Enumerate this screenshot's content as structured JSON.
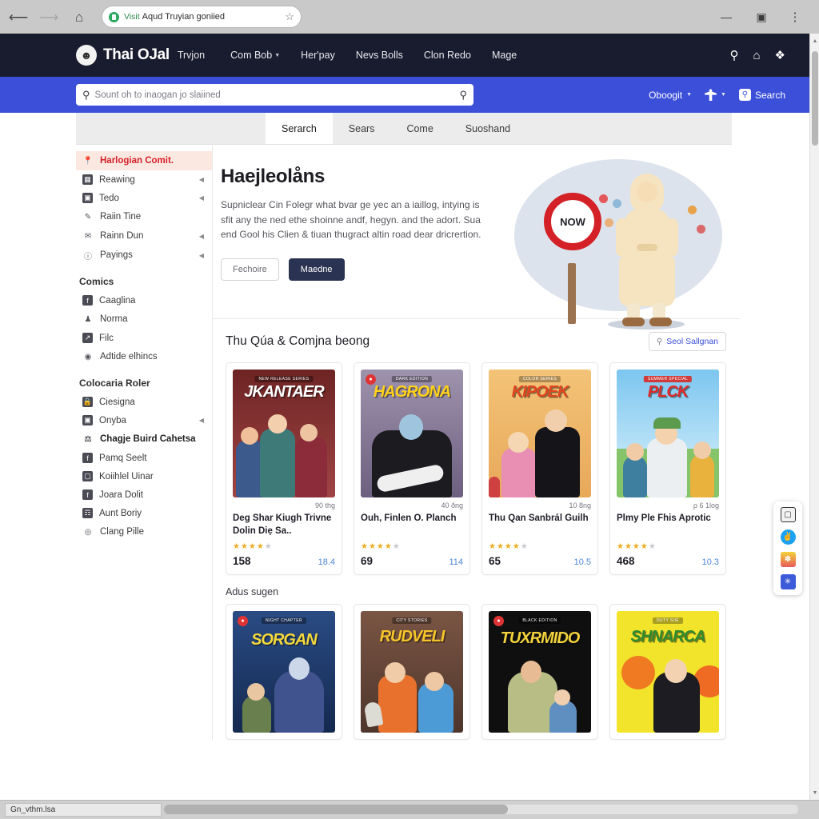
{
  "browser": {
    "back_icon": "back-arrow-icon",
    "forward_icon": "forward-arrow-icon",
    "home_icon": "home-icon",
    "secure_label": "Visit",
    "url_text": "Aqud Truyian goniied",
    "star_icon": "★",
    "minimize_label": "—",
    "maximize_label": "▣",
    "menu_label": "⋮"
  },
  "topnav": {
    "logo_glyph": "☻",
    "brand": "Thai OJal",
    "brand_sub": "Trvjon",
    "links": [
      {
        "label": "Com Bob",
        "has_caret": true
      },
      {
        "label": "Her'pay",
        "has_caret": false
      },
      {
        "label": "Nevs Bolls",
        "has_caret": false
      },
      {
        "label": "Clon Redo",
        "has_caret": false
      },
      {
        "label": "Mage",
        "has_caret": false
      }
    ],
    "icons": [
      "search-icon",
      "home-icon",
      "apps-icon"
    ]
  },
  "searchbar": {
    "placeholder": "Sount oh to inaogan jo slaiined",
    "account_label": "Oboogit",
    "search_label": "Search"
  },
  "tabs": [
    {
      "label": "Serarch",
      "active": true
    },
    {
      "label": "Sears",
      "active": false
    },
    {
      "label": "Come",
      "active": false
    },
    {
      "label": "Suoshand",
      "active": false
    }
  ],
  "sidebar": {
    "primary": [
      {
        "label": "Harlogian Comit.",
        "icon": "location-pin-icon",
        "active": true,
        "arrow": false
      },
      {
        "label": "Reawing",
        "icon": "calendar-icon",
        "active": false,
        "arrow": true
      },
      {
        "label": "Tedo",
        "icon": "image-icon",
        "active": false,
        "arrow": true
      },
      {
        "label": "Raiin Tine",
        "icon": "pencil-icon",
        "active": false,
        "arrow": false
      },
      {
        "label": "Rainn Dun",
        "icon": "envelope-icon",
        "active": false,
        "arrow": true
      },
      {
        "label": "Payings",
        "icon": "info-icon",
        "active": false,
        "arrow": true
      }
    ],
    "group1_title": "Comics",
    "group1": [
      {
        "label": "Caaglina",
        "icon": "facebook-icon",
        "arrow": false
      },
      {
        "label": "Norma",
        "icon": "user-icon",
        "arrow": false
      },
      {
        "label": "Filc",
        "icon": "share-icon",
        "arrow": false
      },
      {
        "label": "Adtide elhincs",
        "icon": "camera-icon",
        "arrow": false
      }
    ],
    "group2_title": "Colocaria Roler",
    "group2": [
      {
        "label": "Ciesigna",
        "icon": "lock-icon",
        "arrow": false,
        "bold": false
      },
      {
        "label": "Onyba",
        "icon": "grid-icon",
        "arrow": true,
        "bold": false
      },
      {
        "label": "Chagje Buird Cahetsa",
        "icon": "badge-icon",
        "arrow": false,
        "bold": true
      },
      {
        "label": "Pamq Seelt",
        "icon": "facebook-icon",
        "arrow": false,
        "bold": false
      },
      {
        "label": "Koiihlel Uinar",
        "icon": "image-icon",
        "arrow": false,
        "bold": false
      },
      {
        "label": "Joara Dolit",
        "icon": "facebook-icon",
        "arrow": false,
        "bold": false
      },
      {
        "label": "Aunt Boriy",
        "icon": "puzzle-icon",
        "arrow": false,
        "bold": false
      },
      {
        "label": "Clang Pille",
        "icon": "circle-icon",
        "arrow": false,
        "bold": false
      }
    ]
  },
  "hero": {
    "title": "Haejleolåns",
    "body": "Supniclear Cin Folegr what bvar ge yec an a iaillog, intying is sfit any the ned ethe shoinne andf, hegyn. and the adort. Sua end Gool his Clien & tiuan thugract altin road dear dricrertion.",
    "btn_secondary": "Fechoire",
    "btn_primary": "Maedne",
    "sign_label": "NOW"
  },
  "section": {
    "title": "Thu Qúa & Comjna beong",
    "action_label": "Seol Sallgnan",
    "cards": [
      {
        "cover_title": "JKANTAER",
        "cover_sub": "NEW RELEASE SERIES",
        "cover_bg": "#7e2b2b",
        "title_color": "#ffffff",
        "pages": "90 thg",
        "title": "Deg Shar Kiugh Trivne Dolin Diẹ Sa..",
        "stars": 4,
        "number": "158",
        "alt": "18.4"
      },
      {
        "cover_title": "HAGRONA",
        "cover_sub": "DARK EDITION",
        "cover_bg": "#8d7fa0",
        "title_color": "#ffd21a",
        "pages": "40 ðng",
        "title": "Ouh, Finlen O. Planch",
        "stars": 4,
        "number": "69",
        "alt": "114"
      },
      {
        "cover_title": "KIPOEK",
        "cover_sub": "COLOR SERIES",
        "cover_bg": "#f0b964",
        "title_color": "#e0461f",
        "pages": "10 8ng",
        "title": "Thu Qan Sanbrál Guilh",
        "stars": 4,
        "number": "65",
        "alt": "10.5"
      },
      {
        "cover_title": "PLCK",
        "cover_sub": "SUMMER SPECIAL",
        "cover_bg": "#68b8e8",
        "title_color": "#e02a2a",
        "pages": "ρ 6 1log",
        "title": "Plmy Ple Fhis Aprotic",
        "stars": 4,
        "number": "468",
        "alt": "10.3"
      }
    ]
  },
  "section2": {
    "title": "Adus sugen",
    "cards": [
      {
        "cover_title": "SORGAN",
        "cover_sub": "NIGHT CHAPTER",
        "cover_bg": "#2c4f86",
        "title_color": "#f5d93a"
      },
      {
        "cover_title": "RUDVELI",
        "cover_sub": "CITY STORIES",
        "cover_bg": "#6b4a3c",
        "title_color": "#f6c52a"
      },
      {
        "cover_title": "TUXRMIDO",
        "cover_sub": "BLACK EDITION",
        "cover_bg": "#121212",
        "title_color": "#f2d23c"
      },
      {
        "cover_title": "SHNARCA",
        "cover_sub": "DUTY SIIE",
        "cover_bg": "#f2e32b",
        "title_color": "#2e8b2e"
      }
    ]
  },
  "share_rail": {
    "items": [
      "note-icon",
      "twitter-icon",
      "kakao-icon",
      "star-icon"
    ]
  },
  "statusbar": {
    "text": "Gn_vthm.lsa"
  },
  "colors": {
    "topnav_bg": "#191c2e",
    "bluebar_bg": "#3b4fd8",
    "accent_red": "#d5202a",
    "link_blue": "#4e86d6",
    "primary_btn": "#2b3352"
  }
}
